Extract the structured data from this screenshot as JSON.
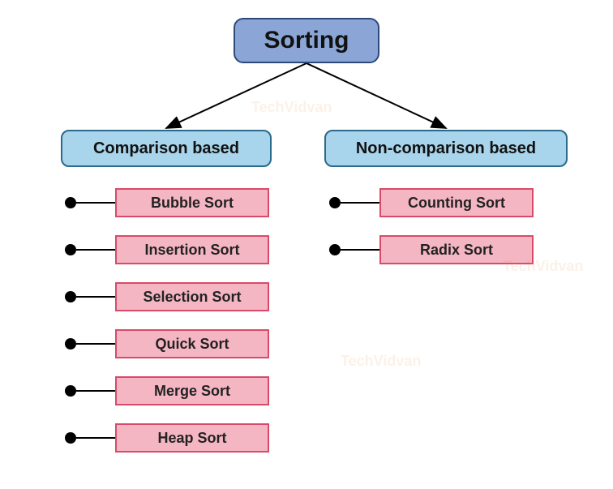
{
  "root": {
    "title": "Sorting"
  },
  "categories": {
    "left": {
      "label": "Comparison based"
    },
    "right": {
      "label": "Non-comparison based"
    }
  },
  "left_items": [
    {
      "label": "Bubble Sort"
    },
    {
      "label": "Insertion Sort"
    },
    {
      "label": "Selection Sort"
    },
    {
      "label": "Quick Sort"
    },
    {
      "label": "Merge Sort"
    },
    {
      "label": "Heap Sort"
    }
  ],
  "right_items": [
    {
      "label": "Counting Sort"
    },
    {
      "label": "Radix Sort"
    }
  ],
  "watermark": "TechVidvan"
}
